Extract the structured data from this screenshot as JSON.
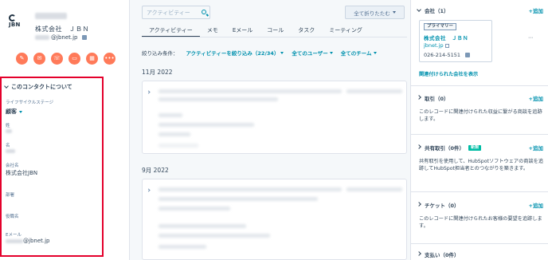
{
  "company": {
    "logo_text": "JBN",
    "name_jp": "株式会社　ＪＢＮ",
    "domain_suffix": "@jbnet.jp"
  },
  "actions": [
    {
      "name": "note-icon",
      "glyph": "✎"
    },
    {
      "name": "email-icon",
      "glyph": "✉"
    },
    {
      "name": "call-icon",
      "glyph": "☏"
    },
    {
      "name": "task-icon",
      "glyph": "▭"
    },
    {
      "name": "meeting-icon",
      "glyph": "▦"
    },
    {
      "name": "more-icon",
      "glyph": "•••"
    }
  ],
  "about": {
    "title": "このコンタクトについて",
    "lifecycle_label": "ライフサイクルステージ",
    "lifecycle_value": "顧客",
    "last_name_label": "姓",
    "first_name_label": "名",
    "company_label": "会社名",
    "company_value": "株式会社JBN",
    "department_label": "部署",
    "job_title_label": "役職名",
    "email_label": "Eメール",
    "email_value": "@jbnet.jp"
  },
  "timeline": {
    "search_placeholder": "アクティビティー",
    "collapse_label": "全て折りたたむ",
    "tabs": [
      "アクティビティー",
      "メモ",
      "Eメール",
      "コール",
      "タスク",
      "ミーティング"
    ],
    "filter_label": "絞り込み条件：",
    "filter_activity": "アクティビティーを絞り込み（22/34）",
    "filter_users": "全てのユーザー",
    "filter_teams": "全てのチーム",
    "month1": "11月 2022",
    "month2": "9月 2022"
  },
  "sidebar": {
    "company_section": "会社（1）",
    "primary_tag": "プライマリー",
    "assoc_company": "株式会社　ＪＢＮ",
    "assoc_domain": "jbnet.jp",
    "assoc_phone": "026-214-5151",
    "view_linked": "関連付けられた会社を表示",
    "add_label": "+追加",
    "deals_section": "取引（0）",
    "deals_text": "このレコードに関連付けられた収益に繋がる商談を追跡します。",
    "shared_section": "共有取引（0件）",
    "new_badge": "新規",
    "shared_text": "共有取引を使用して、HubSpotソフトウェアの商談を追跡してHubSpot担当者とのつながりを築きます。",
    "tickets_section": "チケット（0）",
    "tickets_text": "このレコードに関連付けられたお客様の要望を追跡します。",
    "payments_section": "支払い（0件）"
  }
}
